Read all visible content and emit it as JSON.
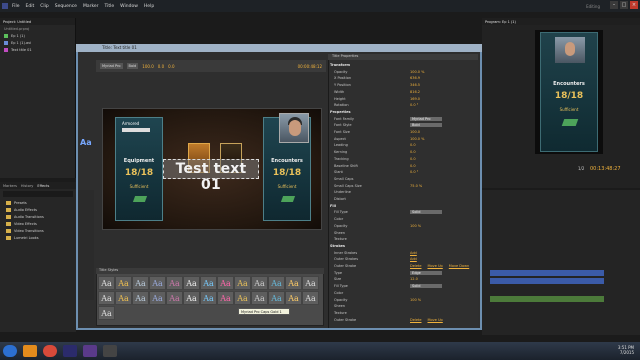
{
  "menu": [
    "File",
    "Edit",
    "Clip",
    "Sequence",
    "Marker",
    "Title",
    "Window",
    "Help"
  ],
  "editing_label": "Editing",
  "project": {
    "tabs": [
      "Project: Untitled",
      "Source: (no clips)",
      "Effect Controls",
      "Audio Track Mixer: V1",
      "Metadata"
    ],
    "title": "Untitled.prproj",
    "items": [
      {
        "name": "Ep 1 (1)",
        "color": "#5cc05c"
      },
      {
        "name": "Ep 1 (1).avi",
        "color": "#6a8cd8"
      },
      {
        "name": "Text title 01",
        "color": "#c04cc0"
      }
    ],
    "count_label": "3 Items"
  },
  "effects": {
    "tabs": [
      "Markers",
      "History",
      "Effects"
    ],
    "folders": [
      "Presets",
      "Audio Effects",
      "Audio Transitions",
      "Video Effects",
      "Video Transitions",
      "Lumetri Looks"
    ]
  },
  "title_window": {
    "title": "Title: Text title 01",
    "font_family": "Myriad Pro",
    "font_style": "Bold",
    "x_value": "100.0",
    "y_value": "0.0",
    "tracking": "0.0",
    "timecode": "00:00:48:12",
    "big_text": "Test text 01",
    "progress_label": "Armored",
    "left_card": {
      "title": "Equipment",
      "value": "18/18",
      "sub": "Sufficient"
    },
    "right_card": {
      "title": "Encounters",
      "value": "18/18",
      "sub": "Sufficient"
    },
    "styles_header": "Title Styles",
    "style_glyph": "Aa",
    "tooltip": "Myriad Pro Caps Gold 1"
  },
  "properties": {
    "header": "Title Properties",
    "rows": [
      {
        "k": "Transform",
        "sec": true
      },
      {
        "k": "Opacity",
        "v": "100.0 %"
      },
      {
        "k": "X Position",
        "v": "636.9"
      },
      {
        "k": "Y Position",
        "v": "346.5"
      },
      {
        "k": "Width",
        "v": "816.2"
      },
      {
        "k": "Height",
        "v": "169.0"
      },
      {
        "k": "Rotation",
        "v": "0.0 °"
      },
      {
        "k": "Properties",
        "sec": true
      },
      {
        "k": "Font Family",
        "v": "Myriad Pro",
        "box": true
      },
      {
        "k": "Font Style",
        "v": "Bold",
        "box": true
      },
      {
        "k": "Font Size",
        "v": "100.0"
      },
      {
        "k": "Aspect",
        "v": "100.0 %"
      },
      {
        "k": "Leading",
        "v": "0.0"
      },
      {
        "k": "Kerning",
        "v": "0.0"
      },
      {
        "k": "Tracking",
        "v": "0.0"
      },
      {
        "k": "Baseline Shift",
        "v": "0.0"
      },
      {
        "k": "Slant",
        "v": "0.0 °"
      },
      {
        "k": "Small Caps",
        "v": ""
      },
      {
        "k": "Small Caps Size",
        "v": "75.0 %"
      },
      {
        "k": "Underline",
        "v": ""
      },
      {
        "k": "Distort",
        "v": ""
      },
      {
        "k": "Fill",
        "sec": true
      },
      {
        "k": "Fill Type",
        "v": "Solid",
        "box": true
      },
      {
        "k": "Color",
        "v": ""
      },
      {
        "k": "Opacity",
        "v": "100 %"
      },
      {
        "k": "Sheen",
        "v": ""
      },
      {
        "k": "Texture",
        "v": ""
      },
      {
        "k": "Strokes",
        "sec": true
      },
      {
        "k": "Inner Strokes",
        "v": "Add",
        "link": true
      },
      {
        "k": "Outer Strokes",
        "v": "Add",
        "link": true
      },
      {
        "k": "Outer Stroke",
        "v": "Delete",
        "link": true,
        "extra": [
          "Move Up",
          "Move Down"
        ]
      },
      {
        "k": "Type",
        "v": "Edge",
        "box": true
      },
      {
        "k": "Size",
        "v": "12.0"
      },
      {
        "k": "Fill Type",
        "v": "Solid",
        "box": true
      },
      {
        "k": "Color",
        "v": ""
      },
      {
        "k": "Opacity",
        "v": "100 %"
      },
      {
        "k": "Sheen",
        "v": ""
      },
      {
        "k": "Texture",
        "v": ""
      },
      {
        "k": "Outer Stroke",
        "v": "Delete",
        "link": true,
        "extra": [
          "Move Up"
        ]
      }
    ]
  },
  "program": {
    "title": "Program: Ep 1 (1)",
    "card": {
      "title": "Encounters",
      "value": "18/18",
      "sub": "Sufficient"
    },
    "timecode": "00:13:48:27",
    "fit": "1/2"
  },
  "clock": {
    "time": "3:51 PM",
    "date": "7/2015"
  }
}
